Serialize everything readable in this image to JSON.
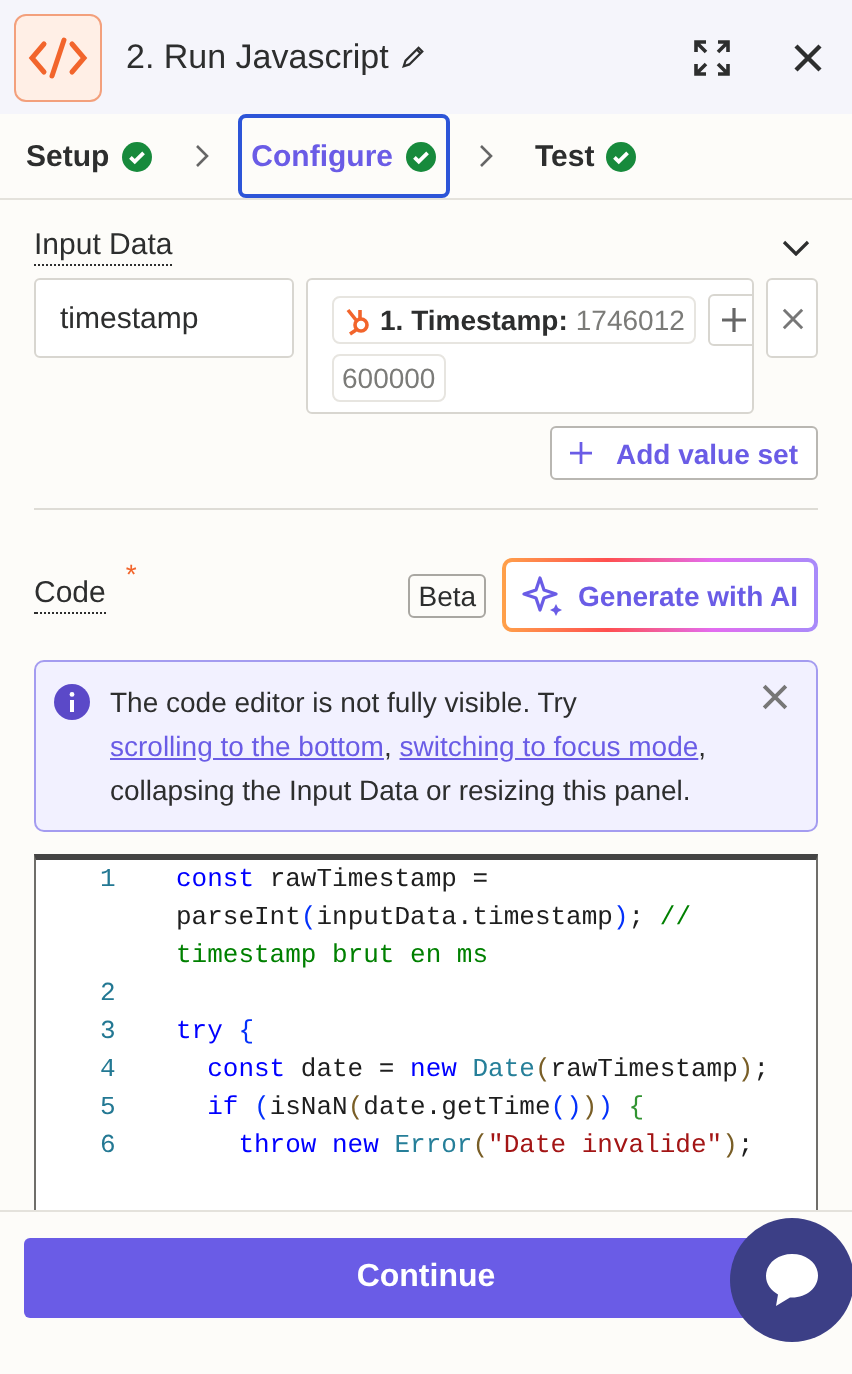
{
  "header": {
    "title": "2. Run Javascript"
  },
  "steps": [
    {
      "label": "Setup",
      "selected": false,
      "done": true
    },
    {
      "label": "Configure",
      "selected": true,
      "done": true
    },
    {
      "label": "Test",
      "selected": false,
      "done": true
    }
  ],
  "input_data": {
    "label": "Input Data",
    "expanded": true,
    "rows": [
      {
        "key": "timestamp",
        "pill_label": "1. Timestamp:",
        "pill_value": "1746012",
        "pill_overflow": "600000"
      }
    ],
    "add_button": "Add value set"
  },
  "code": {
    "label": "Code",
    "required_mark": "*",
    "badge": "Beta",
    "ai_button": "Generate with AI"
  },
  "notice": {
    "text_before": "The code editor is not fully visible. Try ",
    "links": [
      "scrolling to the bottom",
      "switching to focus mode"
    ],
    "separator": ", ",
    "text_after": ", collapsing the Input Data or resizing this panel."
  },
  "editor": {
    "lines": [
      {
        "number": "1",
        "tokens": [
          {
            "kind": "keyword",
            "text": "const "
          },
          {
            "kind": "plain",
            "text": "rawTimestamp = parseInt"
          },
          {
            "kind": "bracket",
            "text": "("
          },
          {
            "kind": "plain",
            "text": "inputData.timestamp"
          },
          {
            "kind": "bracket",
            "text": ")"
          },
          {
            "kind": "plain",
            "text": "; "
          },
          {
            "kind": "comment",
            "text": "// timestamp brut en ms"
          }
        ]
      },
      {
        "number": "2"
      },
      {
        "number": "3",
        "tokens": [
          {
            "kind": "keyword",
            "text": "try "
          },
          {
            "kind": "bracket",
            "text": "{"
          }
        ],
        "children": [
          {
            "number": "4",
            "tokens": [
              {
                "kind": "keyword",
                "text": "const "
              },
              {
                "kind": "plain",
                "text": "date = "
              },
              {
                "kind": "keyword",
                "text": "new "
              },
              {
                "kind": "class",
                "text": "Date"
              },
              {
                "kind": "paren",
                "text": "("
              },
              {
                "kind": "plain",
                "text": "rawTimestamp"
              },
              {
                "kind": "paren",
                "text": ")"
              },
              {
                "kind": "plain",
                "text": ";"
              }
            ]
          },
          {
            "number": "5",
            "tokens": [
              {
                "kind": "keyword",
                "text": "if "
              },
              {
                "kind": "bracket",
                "text": "("
              },
              {
                "kind": "plain",
                "text": "isNaN"
              },
              {
                "kind": "paren",
                "text": "("
              },
              {
                "kind": "plain",
                "text": "date.getTime"
              },
              {
                "kind": "bracket",
                "text": "()"
              },
              {
                "kind": "paren",
                "text": ")"
              },
              {
                "kind": "bracket",
                "text": ")"
              },
              {
                "kind": "brace",
                "text": " {"
              }
            ],
            "children": [
              {
                "number": "6",
                "tokens": [
                  {
                    "kind": "keyword",
                    "text": "throw new "
                  },
                  {
                    "kind": "class",
                    "text": "Error"
                  },
                  {
                    "kind": "paren",
                    "text": "("
                  },
                  {
                    "kind": "string",
                    "text": "\"Date invalide\""
                  },
                  {
                    "kind": "paren",
                    "text": ")"
                  },
                  {
                    "kind": "plain",
                    "text": ";"
                  }
                ]
              }
            ]
          }
        ]
      }
    ]
  },
  "footer": {
    "button": "Continue"
  }
}
